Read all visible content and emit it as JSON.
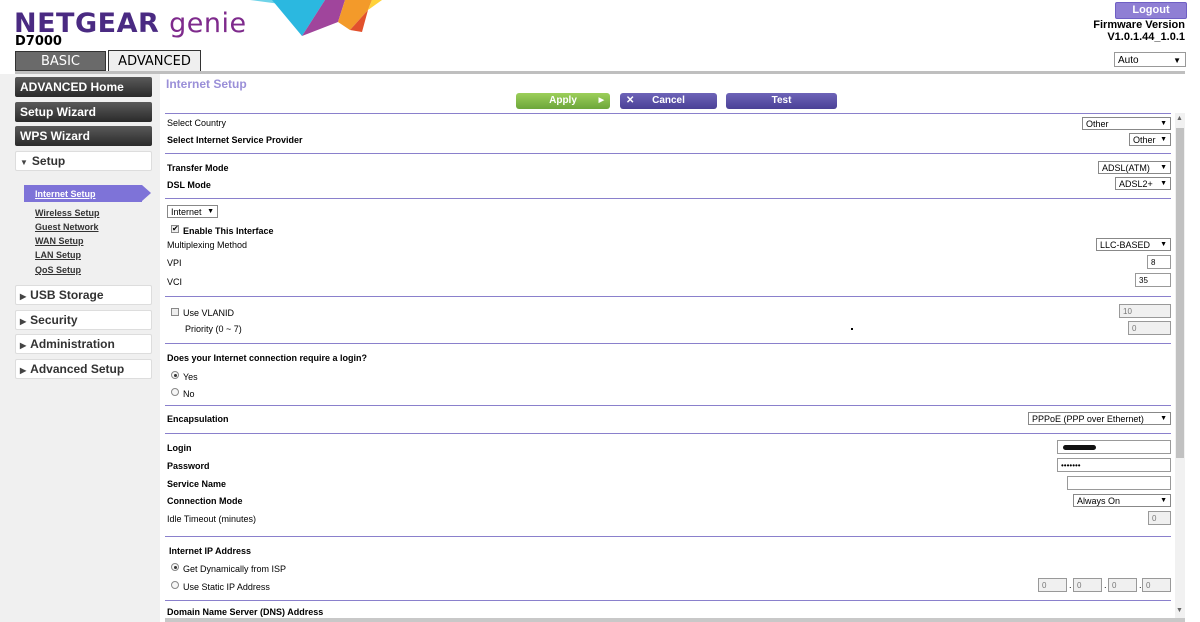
{
  "header": {
    "brand": "NETGEAR",
    "brand_suffix": "genie",
    "model": "D7000",
    "logout_label": "Logout",
    "firmware_label": "Firmware Version",
    "firmware_version": "V1.0.1.44_1.0.1",
    "language": "Auto",
    "tabs": [
      {
        "label": "BASIC",
        "active": false
      },
      {
        "label": "ADVANCED",
        "active": true
      }
    ],
    "colors": {
      "brand": "#4a2a82",
      "accent": "#7e73d8",
      "apply": "#7cb84a"
    }
  },
  "sidebar": {
    "primary": [
      "ADVANCED Home",
      "Setup Wizard",
      "WPS Wizard"
    ],
    "setup_label": "Setup",
    "setup_items": [
      "Internet Setup",
      "Wireless Setup",
      "Guest Network",
      "WAN Setup",
      "LAN Setup",
      "QoS Setup"
    ],
    "active_item": "Internet Setup",
    "sections": [
      "USB Storage",
      "Security",
      "Administration",
      "Advanced Setup"
    ]
  },
  "main": {
    "title": "Internet Setup",
    "buttons": {
      "apply": "Apply",
      "cancel": "Cancel",
      "test": "Test"
    },
    "country": {
      "label": "Select Country",
      "value": "Other"
    },
    "isp": {
      "label": "Select Internet Service Provider",
      "value": "Other"
    },
    "transfer_mode": {
      "label": "Transfer Mode",
      "value": "ADSL(ATM)"
    },
    "dsl_mode": {
      "label": "DSL Mode",
      "value": "ADSL2+"
    },
    "interface": {
      "value": "Internet",
      "enable_label": "Enable This Interface",
      "enabled": true
    },
    "multiplexing": {
      "label": "Multiplexing Method",
      "value": "LLC-BASED"
    },
    "vpi": {
      "label": "VPI",
      "value": "8"
    },
    "vci": {
      "label": "VCI",
      "value": "35"
    },
    "vlan": {
      "label": "Use VLANID",
      "checked": false,
      "value": "10",
      "priority_label": "Priority (0 ~ 7)",
      "priority_value": "0"
    },
    "login_question": {
      "label": "Does your Internet connection require a login?",
      "yes": "Yes",
      "no": "No",
      "selected": "Yes"
    },
    "encapsulation": {
      "label": "Encapsulation",
      "value": "PPPoE (PPP over Ethernet)"
    },
    "login": {
      "label": "Login",
      "value": ""
    },
    "password": {
      "label": "Password",
      "value": "•••••••"
    },
    "service_name": {
      "label": "Service Name",
      "value": ""
    },
    "connection_mode": {
      "label": "Connection Mode",
      "value": "Always On"
    },
    "idle_timeout": {
      "label": "Idle Timeout (minutes)",
      "value": "0"
    },
    "ip_address": {
      "label": "Internet IP Address",
      "dynamic": "Get Dynamically from ISP",
      "static": "Use Static IP Address",
      "selected": "dynamic",
      "octets": [
        "0",
        "0",
        "0",
        "0"
      ],
      "dot": "."
    },
    "dns": {
      "label": "Domain Name Server (DNS) Address"
    }
  }
}
